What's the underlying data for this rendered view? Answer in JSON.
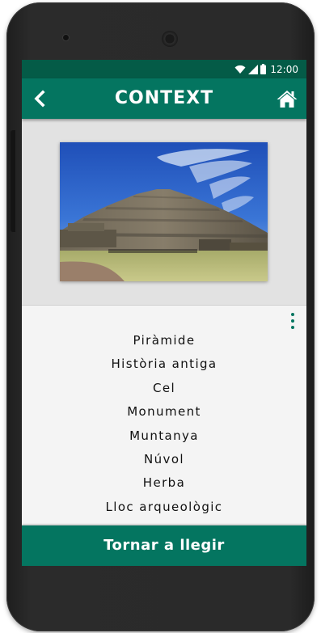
{
  "status_bar": {
    "time": "12:00",
    "icons": [
      "wifi-icon",
      "signal-icon",
      "battery-icon"
    ]
  },
  "app_bar": {
    "title": "CONTEXT",
    "back_icon": "chevron-left-icon",
    "home_icon": "home-icon"
  },
  "photo": {
    "subject": "pyramid-photo"
  },
  "tags": [
    "Piràmide",
    "Història antiga",
    "Cel",
    "Monument",
    "Muntanya",
    "Núvol",
    "Herba",
    "Lloc arqueològic"
  ],
  "menu_icon": "more-vertical-icon",
  "bottom_button": {
    "label": "Tornar a llegir"
  },
  "colors": {
    "status_bar": "#045b47",
    "primary": "#047560",
    "image_background": "#e2e2e2",
    "list_background": "#f4f4f4"
  }
}
